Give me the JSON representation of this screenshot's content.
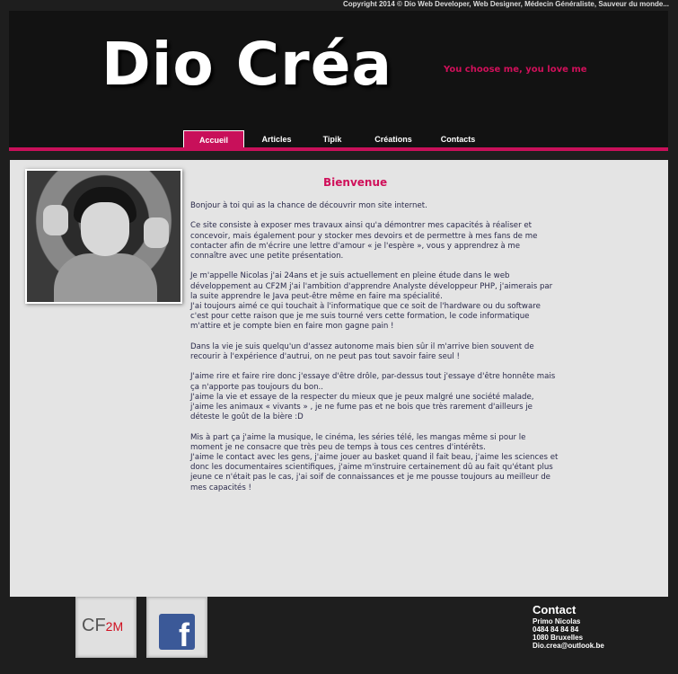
{
  "copyright": "Copyright 2014 © Dio Web Developer, Web Designer, Médecin Généraliste, Sauveur du monde...",
  "header": {
    "logo": "Dio Créa",
    "tagline": "You choose me, you love me"
  },
  "nav": {
    "items": [
      {
        "label": "Accueil",
        "active": true
      },
      {
        "label": "Articles"
      },
      {
        "label": "Tipik"
      },
      {
        "label": "Créations"
      },
      {
        "label": "Contacts"
      }
    ]
  },
  "main": {
    "title": "Bienvenue",
    "paragraphs": [
      "Bonjour à toi qui as la chance de découvrir mon site internet.",
      "Ce site consiste à exposer mes travaux ainsi qu'a démontrer mes capacités à réaliser et concevoir, mais également pour y stocker mes devoirs et de permettre à mes fans de me contacter afin de m'écrire une lettre d'amour « je l'espère », vous y apprendrez à me connaître avec une petite présentation.",
      "Je m'appelle Nicolas j'ai 24ans et je suis actuellement en pleine étude dans le web développement au CF2M j'ai l'ambition d'apprendre Analyste développeur PHP, j'aimerais par la suite apprendre le Java peut-être même en faire ma spécialité.\nJ'ai toujours aimé ce qui touchait à l'informatique que ce soit de l'hardware ou du software c'est pour cette raison que je me suis tourné vers cette formation, le code informatique m'attire et je compte bien en faire mon gagne pain !",
      "Dans la vie je suis quelqu'un d'assez autonome mais bien sûr il m'arrive bien souvent de recourir à l'expérience d'autrui, on ne peut pas tout savoir faire seul !",
      "J'aime rire et faire rire donc j'essaye d'être drôle, par-dessus tout j'essaye d'être honnête mais ça n'apporte pas toujours du bon..\nJ'aime la vie et essaye de la respecter du mieux que je peux malgré une société malade, j'aime les animaux « vivants » , je ne fume pas et ne bois que très rarement d'ailleurs je déteste le goût de la bière :D",
      "Mis à part ça j'aime la musique, le cinéma, les séries télé, les mangas même si pour le moment je ne consacre que très peu de temps à tous ces centres d'intérêts.\nJ'aime le contact avec les gens, j'aime jouer au basket quand il fait beau, j'aime les sciences et donc les documentaires scientifiques, j'aime m'instruire certainement dû au fait qu'étant plus jeune ce n'était pas le cas, j'ai soif de connaissances et je me pousse toujours au meilleur de mes capacités !"
    ]
  },
  "footer": {
    "cf2m_logo": "CF",
    "cf2m_sub": "2M",
    "facebook_letter": "f",
    "contact": {
      "title": "Contact",
      "name": "Primo Nicolas",
      "phone": "0484 84 84 84",
      "city": "1080 Bruxelles",
      "email": "Dio.crea@outlook.be"
    }
  },
  "colors": {
    "accent": "#c8105a",
    "background": "#1e1e1e",
    "header": "#121212",
    "content": "#e4e4e4",
    "facebook": "#3b5998"
  }
}
